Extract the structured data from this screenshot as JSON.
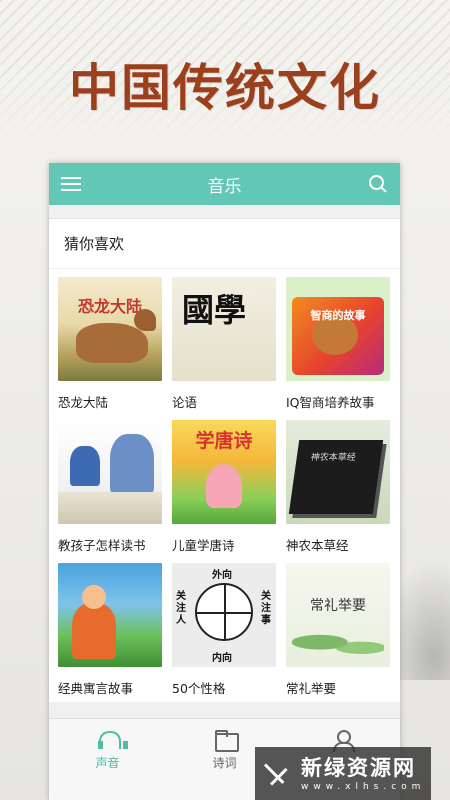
{
  "headline": "中国传统文化",
  "appbar": {
    "title": "音乐",
    "menu_icon": "hamburger-menu-icon",
    "search_icon": "search-icon",
    "accent_color": "#63c7b6"
  },
  "section": {
    "title": "猜你喜欢"
  },
  "items": [
    {
      "label": "恐龙大陆",
      "cover_text": "恐龙大陆"
    },
    {
      "label": "论语",
      "cover_text": "國學"
    },
    {
      "label": "IQ智商培养故事",
      "cover_text": "智商的故事"
    },
    {
      "label": "教孩子怎样读书",
      "cover_text": ""
    },
    {
      "label": "儿童学唐诗",
      "cover_text": "学唐诗"
    },
    {
      "label": "神农本草经",
      "cover_text": "神农本草经"
    },
    {
      "label": "经典寓言故事",
      "cover_text": ""
    },
    {
      "label": "50个性格",
      "cover_text": {
        "top": "外向",
        "bottom": "内向",
        "left": "关注人",
        "right": "关注事"
      }
    },
    {
      "label": "常礼举要",
      "cover_text": "常礼举要"
    }
  ],
  "bottom_nav": [
    {
      "label": "声音",
      "icon": "headphones-icon",
      "active": true
    },
    {
      "label": "诗词",
      "icon": "folder-icon",
      "active": false
    },
    {
      "label": "",
      "icon": "person-icon",
      "active": false
    }
  ],
  "watermark": {
    "text": "新绿资源网",
    "url": "www.xlhs.com"
  }
}
